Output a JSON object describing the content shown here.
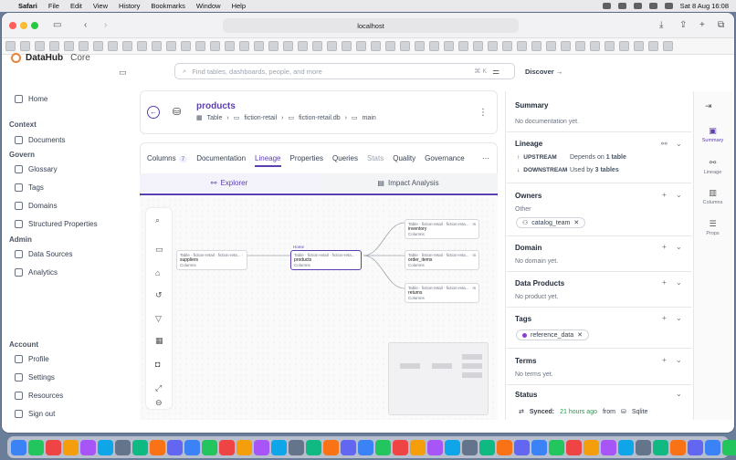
{
  "menubar": {
    "app": "Safari",
    "items": [
      "File",
      "Edit",
      "View",
      "History",
      "Bookmarks",
      "Window",
      "Help"
    ],
    "clock": "Sat 8 Aug  16:08"
  },
  "browser": {
    "url": "localhost"
  },
  "app": {
    "brand": "DataHub",
    "edition": "Core",
    "search_placeholder": "Find tables, dashboards, people, and more",
    "search_shortcut": "⌘ K",
    "discover": "Discover →"
  },
  "sidebar": {
    "home": "Home",
    "context_title": "Context",
    "documents": "Documents",
    "govern_title": "Govern",
    "glossary": "Glossary",
    "tags": "Tags",
    "domains": "Domains",
    "structured_properties": "Structured Properties",
    "admin_title": "Admin",
    "data_sources": "Data Sources",
    "analytics": "Analytics",
    "account_title": "Account",
    "profile": "Profile",
    "settings": "Settings",
    "resources": "Resources",
    "sign_out": "Sign out"
  },
  "entity": {
    "name": "products",
    "type": "Table",
    "crumb1": "fiction-retail",
    "crumb2": "fiction-retail.db",
    "crumb3": "main"
  },
  "tabs": {
    "columns": "Columns",
    "columns_count": "7",
    "documentation": "Documentation",
    "lineage": "Lineage",
    "properties": "Properties",
    "queries": "Queries",
    "stats": "Stats",
    "quality": "Quality",
    "governance": "Governance"
  },
  "subtabs": {
    "explorer": "Explorer",
    "impact": "Impact Analysis"
  },
  "lineage_nodes": {
    "upstream": {
      "name": "suppliers",
      "meta": "Table · fiction-retail · fiction-reta... · main",
      "columns": "Columns"
    },
    "center": {
      "name": "products",
      "meta": "Table · fiction-retail · fiction-reta... · main",
      "columns": "Columns",
      "badge": "Home"
    },
    "down1": {
      "name": "inventory",
      "meta": "Table · fiction-retail · fiction-reta... · main",
      "columns": "Columns"
    },
    "down2": {
      "name": "order_items",
      "meta": "Table · fiction-retail · fiction-reta... · main",
      "columns": "Columns"
    },
    "down3": {
      "name": "returns",
      "meta": "Table · fiction-retail · fiction-reta... · main",
      "columns": "Columns"
    }
  },
  "panel": {
    "summary_title": "Summary",
    "summary_text": "No documentation yet.",
    "lineage_title": "Lineage",
    "upstream_label": "UPSTREAM",
    "upstream_text": "Depends on",
    "upstream_count": "1 table",
    "downstream_label": "DOWNSTREAM",
    "downstream_text": "Used by",
    "downstream_count": "3 tables",
    "owners_title": "Owners",
    "owners_other": "Other",
    "owner_chip": "catalog_team",
    "domain_title": "Domain",
    "domain_text": "No domain yet.",
    "products_title": "Data Products",
    "products_text": "No product yet.",
    "tags_title": "Tags",
    "tag_chip": "reference_data",
    "terms_title": "Terms",
    "terms_text": "No terms yet.",
    "status_title": "Status",
    "synced_label": "Synced:",
    "synced_time": "21 hours ago",
    "synced_from": "from",
    "synced_source": "Sqlite"
  },
  "rail": {
    "summary": "Summary",
    "lineage": "Lineage",
    "columns": "Columns",
    "props": "Props"
  },
  "colors": {
    "accent": "#5b3fb0",
    "brand": "#e8853b",
    "tag_dot": "#8b3fd0"
  }
}
